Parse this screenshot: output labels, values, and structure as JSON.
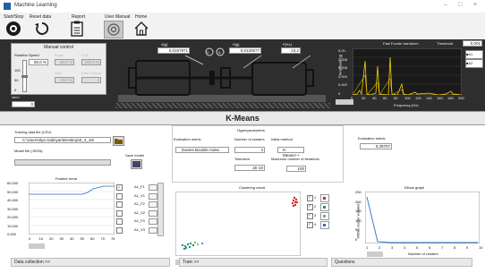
{
  "window": {
    "title": "Machine Learning"
  },
  "toolbar": {
    "start_stop": "Start/Stop",
    "reset_data": "Reset data",
    "report": "Report",
    "user_manual": "User Manual",
    "home": "Home"
  },
  "manual_control": {
    "title": "Manual control",
    "rotation_speed_label": "Rotation Speed",
    "rotation_speed_value": "50,0 %",
    "begin_label": "Begin",
    "begin_value": "50,0 %",
    "end_label": "End",
    "end_value": "100,0 %",
    "step_label": "Step",
    "step_value": "10,0 %",
    "step_interval_label": "Step interval",
    "step_interval_value": "2",
    "scale_max": "100",
    "scale_mid": "50",
    "scale_min": "0",
    "label_text": "label",
    "label_value": "0"
  },
  "machine": {
    "a_label": "A[g]",
    "a_value": "0,0157971",
    "h_label": "H[g]",
    "h_value": "0,0120677",
    "f_label": "F[Hz]",
    "f_value": "23,2",
    "v_symbol": "V",
    "a_symbol": "A"
  },
  "fft": {
    "title": "Fast Fourier transform",
    "threshold_label": "Threshold",
    "threshold_value": "0,001",
    "ylabel": "Amplitude (g)",
    "xlabel": "Frequency (Hz)",
    "y_ticks": [
      "0,01-",
      "0,008",
      "0,006",
      "0,004",
      "0,002",
      "0"
    ],
    "x_ticks": [
      "0",
      "20",
      "40",
      "60",
      "80",
      "100",
      "120",
      "140",
      "160",
      "180",
      "200"
    ],
    "legend": [
      "A1",
      "A2"
    ]
  },
  "kmeans": {
    "title": "K-Means"
  },
  "left": {
    "training_label": "Training data file (CSV)",
    "training_path": "C:\\Users\\Ilya Galinyan\\Desktop\\0_4_18\\",
    "model_label": "Model file (JSON)",
    "model_path": "",
    "save_model": "Save model"
  },
  "trend": {
    "title": "Feature trend",
    "y_ticks": [
      "60,000",
      "50,000",
      "40,000",
      "30,000",
      "20,000",
      "10,000",
      "0,000"
    ],
    "x_ticks": [
      "0",
      "10",
      "20",
      "30",
      "40",
      "50",
      "60",
      "70",
      "76"
    ],
    "features": [
      "A1_F1",
      "A1_V1",
      "A1_F2",
      "A1_V2",
      "A1_F3",
      "A1_V3"
    ]
  },
  "hyper": {
    "title": "Hyperparameters",
    "eval_metric_label": "Evaluation metric",
    "eval_metric_value": "Davies Bouldin Index",
    "clusters_label": "Number of clusters",
    "clusters_value": "4",
    "init_label": "Initial method",
    "init_value": "K-Means++",
    "tolerance_label": "Tolerance",
    "tolerance_value": "1E-10",
    "max_iter_label": "Maximum number of iterations",
    "max_iter_value": "100"
  },
  "evaluation": {
    "label": "Evaluation metric",
    "value": "0,28707"
  },
  "clustering": {
    "title": "Clustering result",
    "legend": [
      "1",
      "2",
      "3",
      "4"
    ]
  },
  "elbow": {
    "title": "Elbow graph",
    "ylabel": "Within cluster variation",
    "xlabel": "Number of clusters",
    "y_ticks": [
      "250",
      "200",
      "150",
      "100",
      "50",
      "0"
    ],
    "x_ticks": [
      "1",
      "2",
      "3",
      "4",
      "5",
      "6",
      "7",
      "8",
      "9",
      "10"
    ]
  },
  "tabs": {
    "data_collection": "Data collection >>",
    "train": "Train >>",
    "questions": "Questions"
  },
  "colors": {
    "accent_yellow": "#f1d500",
    "dark_bg": "#2e2e2e",
    "cluster_red": "#d62828",
    "cluster_teal": "#2a8f7e"
  }
}
